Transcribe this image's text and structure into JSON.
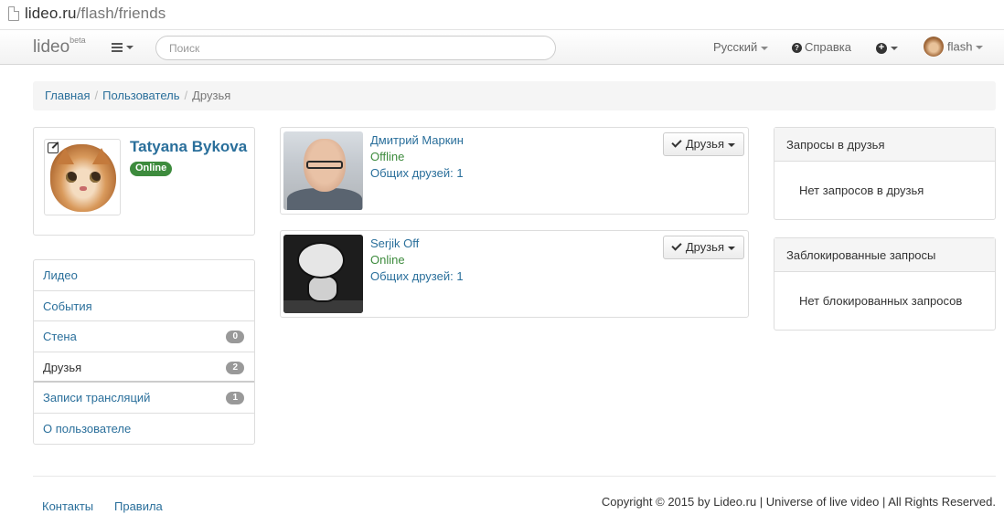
{
  "browser": {
    "url_host": "lideo.ru",
    "url_path": "/flash/friends"
  },
  "navbar": {
    "brand": "lideo",
    "brand_sup": "beta",
    "search_placeholder": "Поиск",
    "language": "Русский",
    "help": "Справка",
    "user": "flash"
  },
  "breadcrumb": {
    "home": "Главная",
    "users": "Пользователь",
    "current": "Друзья"
  },
  "profile": {
    "name": "Tatyana Bykova",
    "status": "Online"
  },
  "sidemenu": {
    "items": [
      {
        "label": "Лидео",
        "badge": ""
      },
      {
        "label": "События",
        "badge": ""
      },
      {
        "label": "Стена",
        "badge": "0"
      },
      {
        "label": "Друзья",
        "badge": "2"
      },
      {
        "label": "Записи трансляций",
        "badge": "1"
      },
      {
        "label": "О пользователе",
        "badge": ""
      }
    ]
  },
  "friends": [
    {
      "name": "Дмитрий Маркин",
      "status": "Offline",
      "mutual": "Общих друзей: 1",
      "button": "Друзья"
    },
    {
      "name": "Serjik Off",
      "status": "Online",
      "mutual": "Общих друзей: 1",
      "button": "Друзья"
    }
  ],
  "panels": {
    "requests_title": "Запросы в друзья",
    "requests_empty": "Нет запросов в друзья",
    "blocked_title": "Заблокированные запросы",
    "blocked_empty": "Нет блокированных запросов"
  },
  "footer": {
    "contacts": "Контакты",
    "rules": "Правила",
    "copyright": "Copyright © 2015 by Lideo.ru | Universe of live video | All Rights Reserved."
  },
  "colors": {
    "link": "#2a6f9b",
    "online_badge": "#3d8b3d",
    "badge_gray": "#999999"
  }
}
